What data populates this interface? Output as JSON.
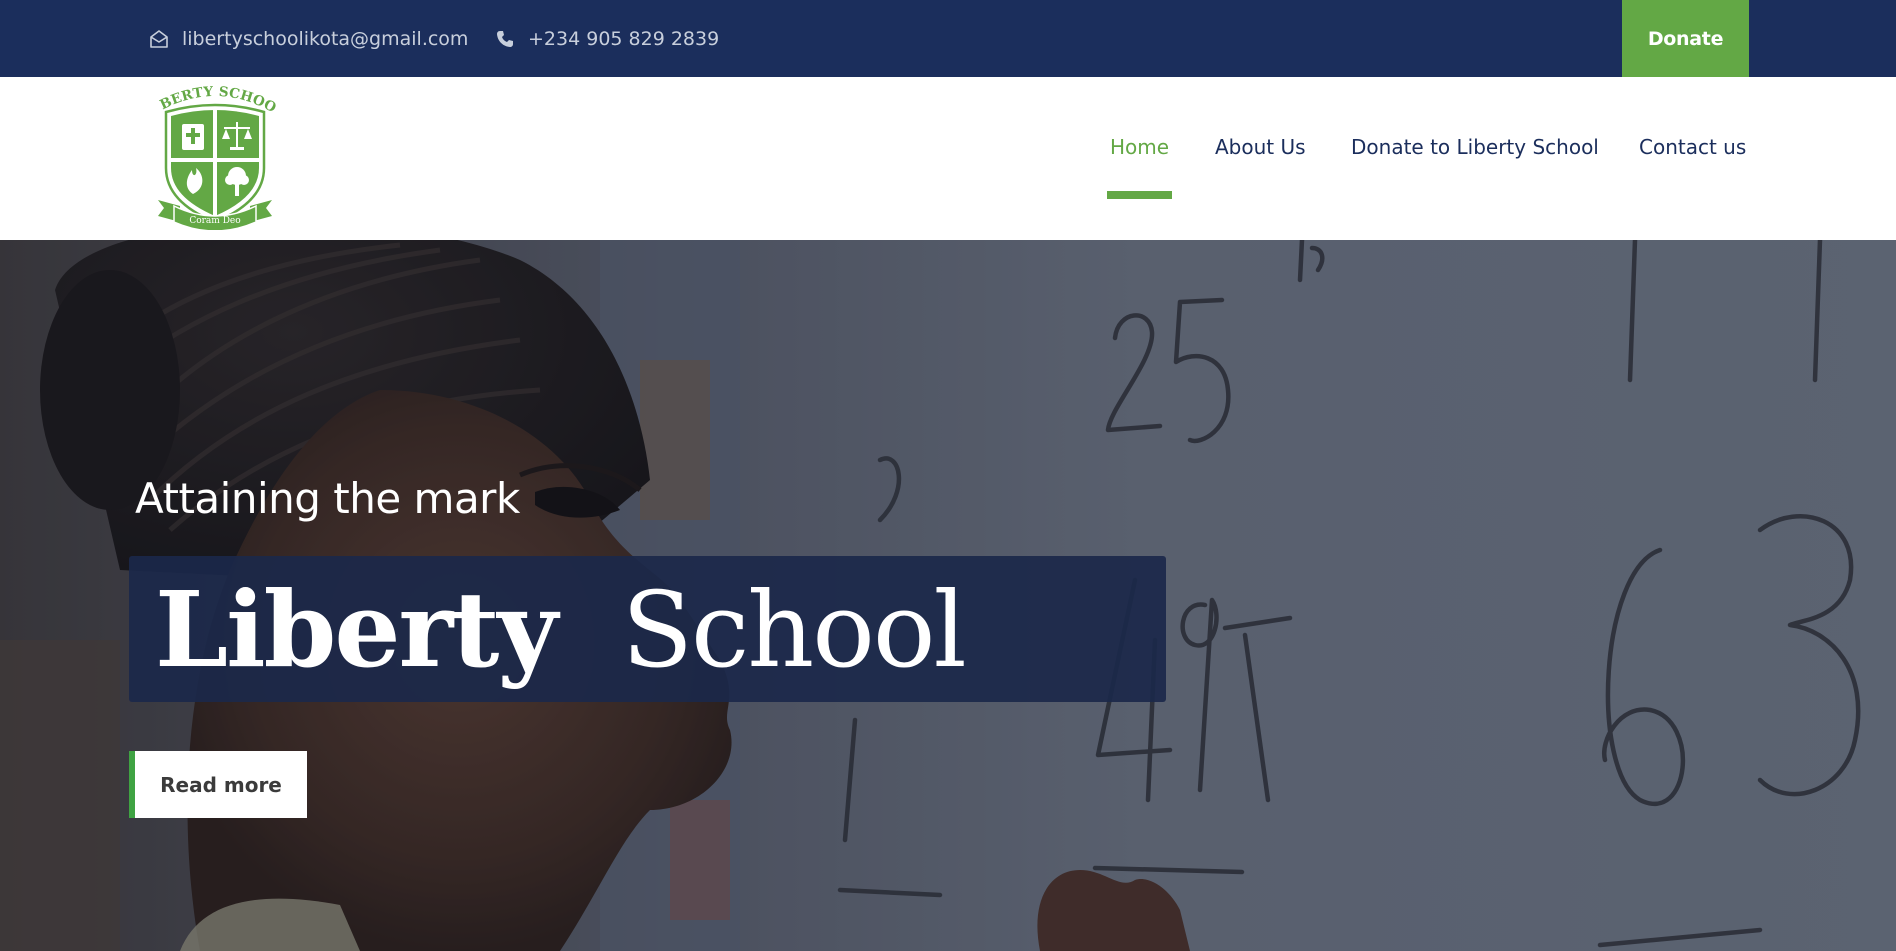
{
  "topbar": {
    "email": "libertyschoolikota@gmail.com",
    "phone": "+234 905 829 2839",
    "donate_label": "Donate",
    "email_icon": "envelope-open-icon",
    "phone_icon": "phone-icon"
  },
  "logo": {
    "top_text": "LIBERTY SCHOOL",
    "motto": "Coram Deo"
  },
  "nav": {
    "items": [
      {
        "label": "Home",
        "active": true
      },
      {
        "label": "About Us",
        "active": false
      },
      {
        "label": "Donate to Liberty School",
        "active": false
      },
      {
        "label": "Contact us",
        "active": false
      }
    ]
  },
  "hero": {
    "subtitle": "Attaining the mark",
    "title_word1": "Liberty",
    "title_word2": "School",
    "button_label": "Read more"
  },
  "colors": {
    "navy": "#1b2e5c",
    "green": "#63a845",
    "accent_green": "#3fa343",
    "white": "#ffffff"
  }
}
